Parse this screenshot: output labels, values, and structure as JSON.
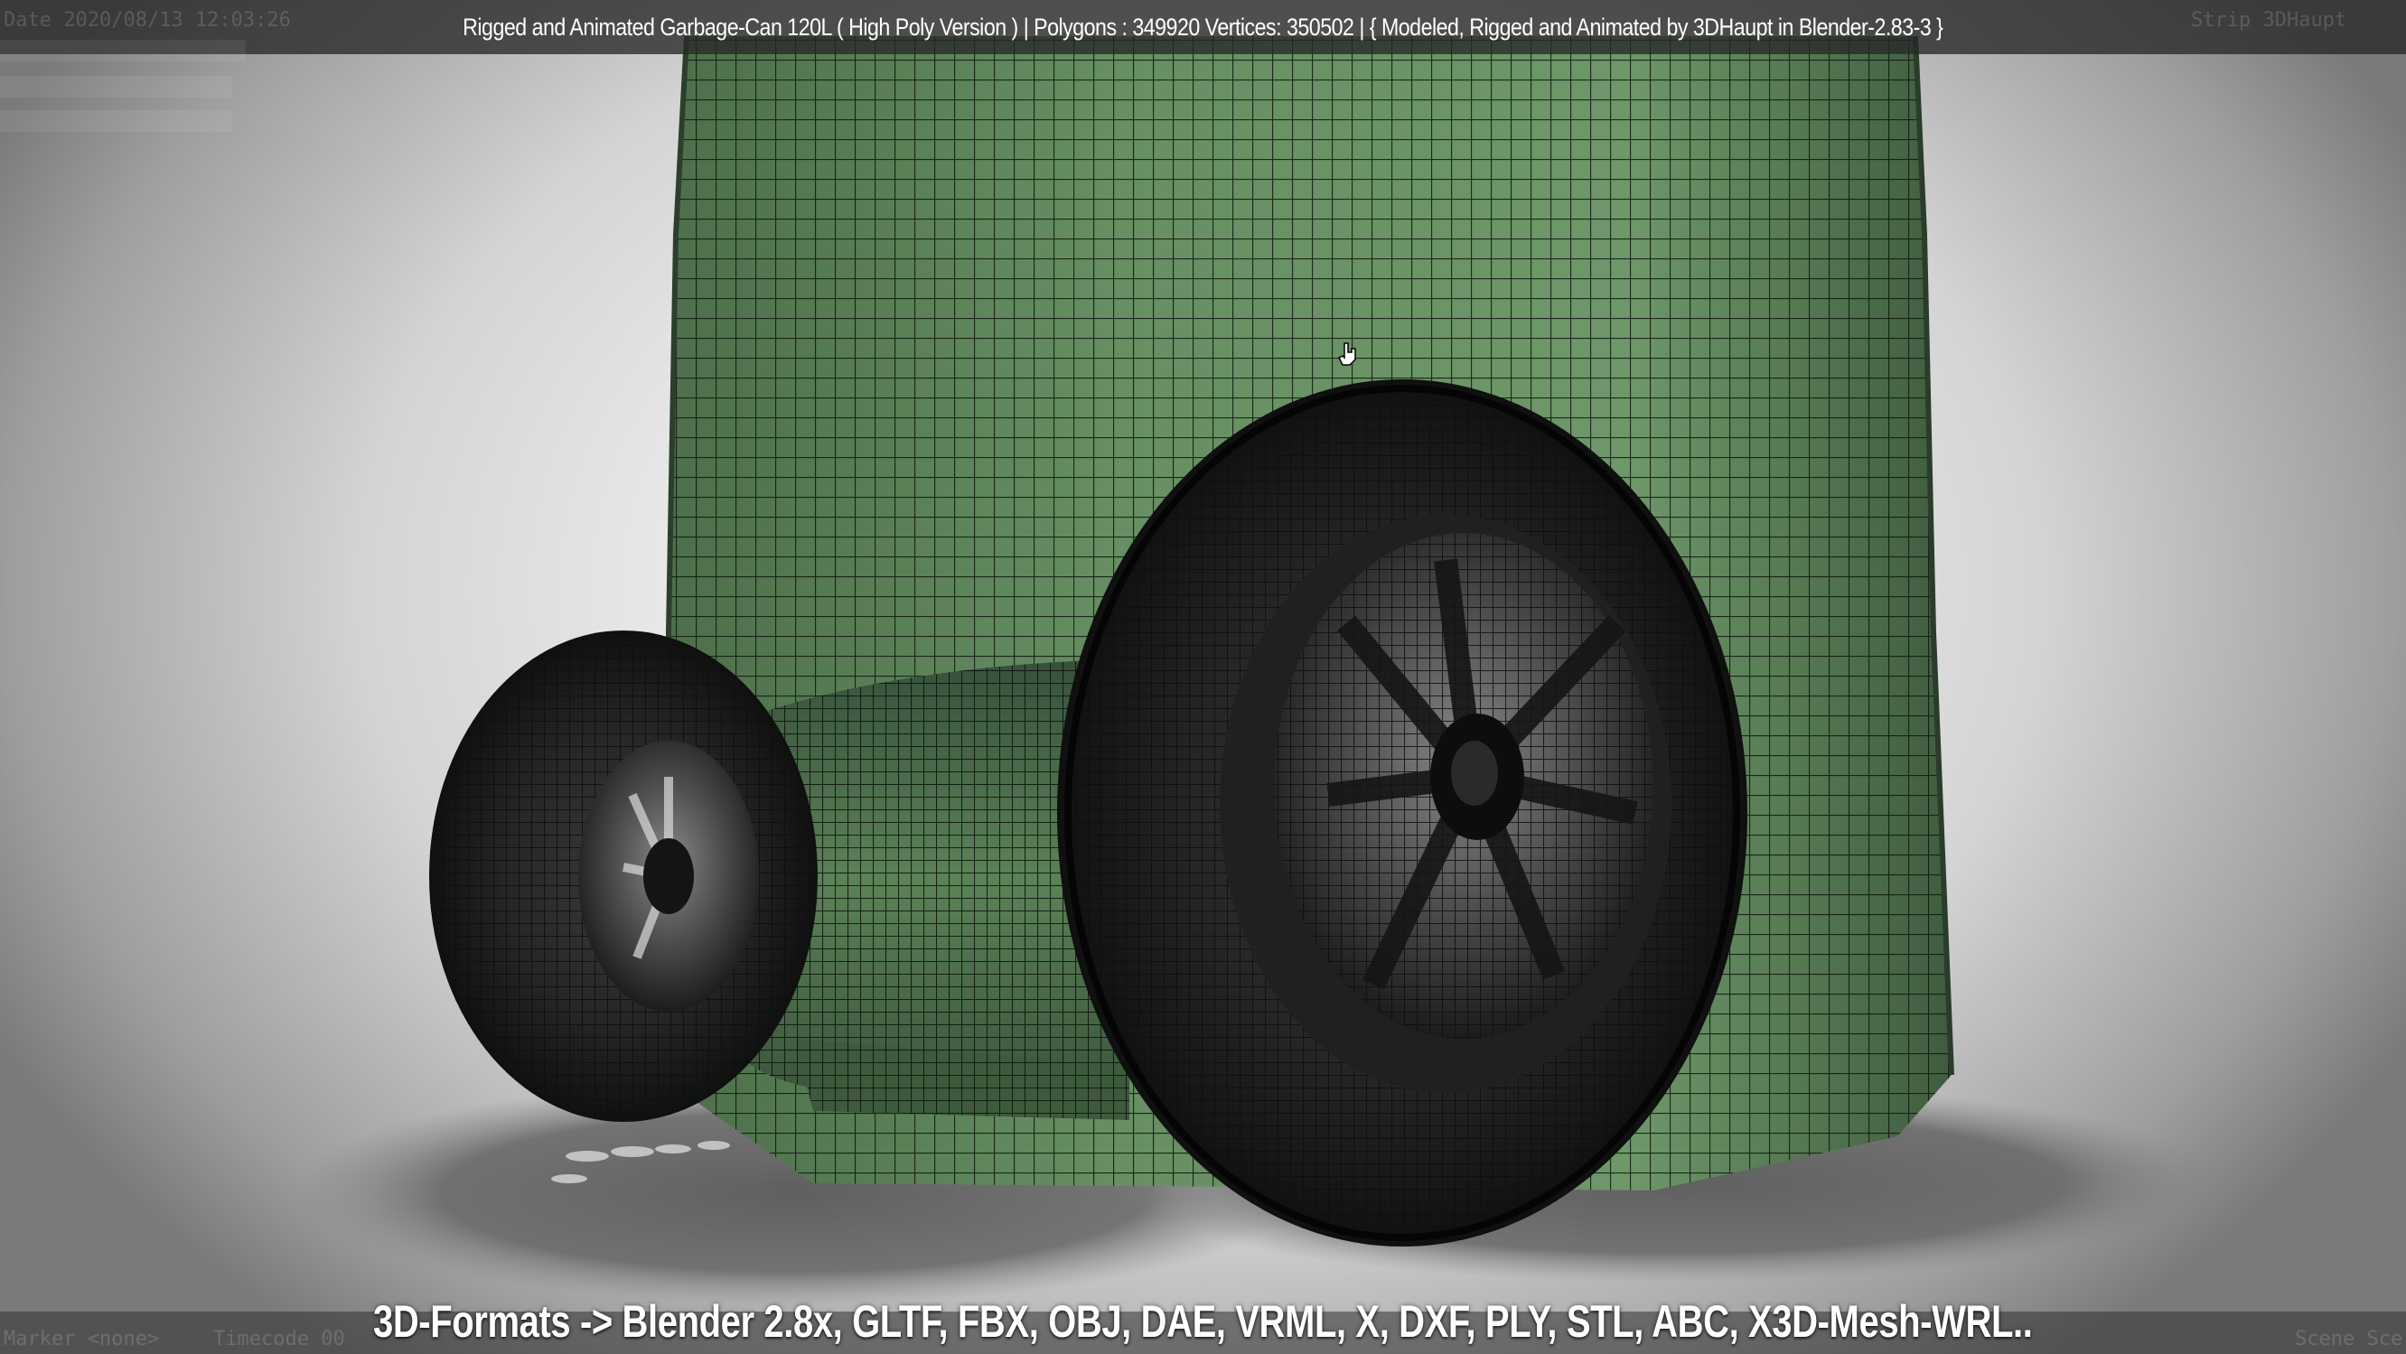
{
  "header": {
    "title": "Rigged and Animated Garbage-Can 120L ( High Poly Version ) |  Polygons : 349920  Vertices: 350502   |  { Modeled, Rigged and Animated by 3DHaupt in Blender-2.83-3 }"
  },
  "overlay": {
    "date_stamp": "Date 2020/08/13 12:03:26",
    "strip_name": "Strip 3DHaupt",
    "marker_label": "Marker <none>",
    "timecode_label": "Timecode 00",
    "scene_label": "Scene Sce"
  },
  "caption": {
    "formats": "3D-Formats -> Blender 2.8x, GLTF, FBX, OBJ, DAE, VRML, X, DXF, PLY, STL, ABC, X3D-Mesh-WRL.."
  },
  "colors": {
    "bin_green": "#5b7f58",
    "tire_black": "#1d1d1d",
    "wire_line": "#0e160e"
  },
  "icons": {
    "cursor": "hand-cursor-icon"
  }
}
